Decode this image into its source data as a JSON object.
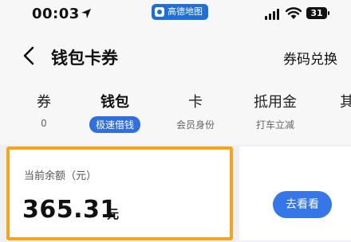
{
  "status_bar": {
    "time": "00:03",
    "app_badge": "高德地图",
    "battery": "31"
  },
  "header": {
    "title": "钱包卡券",
    "right_link": "券码兑换"
  },
  "tabs": [
    {
      "label": "券",
      "sub": "0"
    },
    {
      "label": "钱包",
      "sub": "极速借钱",
      "active": true
    },
    {
      "label": "卡",
      "sub": "会员身份"
    },
    {
      "label": "抵用金",
      "sub": "打车立减"
    },
    {
      "label": "其",
      "sub": ""
    }
  ],
  "balance_card": {
    "label": "当前余额（元）",
    "amount": "365.31",
    "unit": "元"
  },
  "action": {
    "button_label": "去看看"
  },
  "colors": {
    "accent": "#2f6fe0",
    "highlight_border": "#f7a41d"
  }
}
